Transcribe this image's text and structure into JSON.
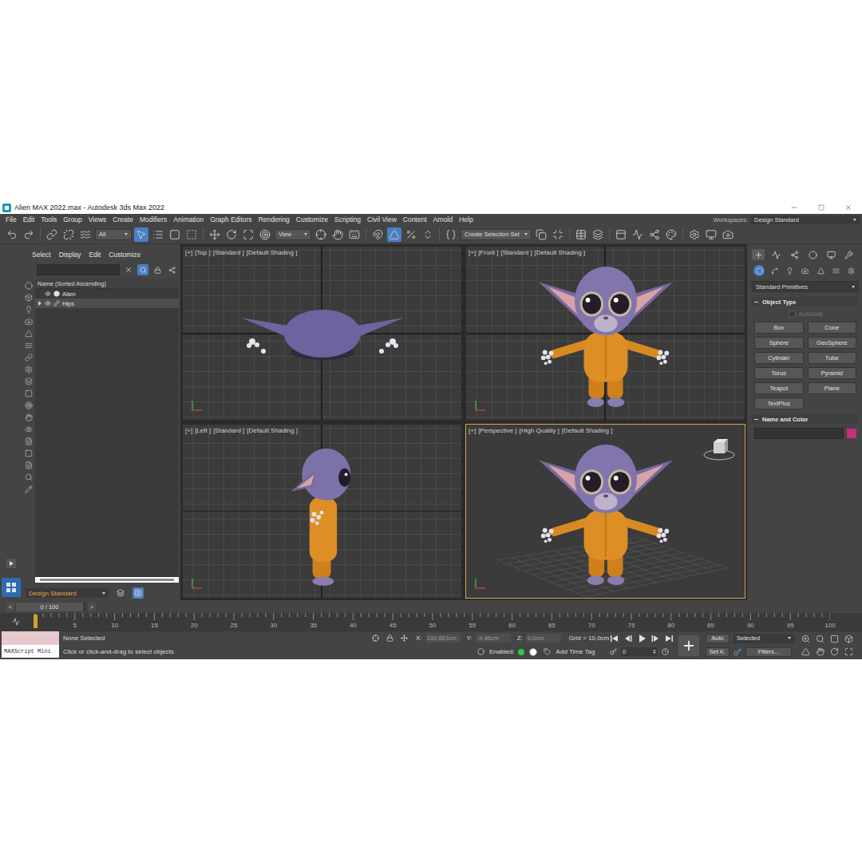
{
  "window": {
    "title": "Alien MAX 2022.max - Autodesk 3ds Max 2022"
  },
  "menu": [
    "File",
    "Edit",
    "Tools",
    "Group",
    "Views",
    "Create",
    "Modifiers",
    "Animation",
    "Graph Editors",
    "Rendering",
    "Customize",
    "Scripting",
    "Civil View",
    "Content",
    "Arnold",
    "Help"
  ],
  "workspace": {
    "label": "Workspaces:",
    "value": "Design Standard"
  },
  "toolbar": [
    {
      "kind": "button",
      "selected": false
    },
    {
      "kind": "button",
      "selected": false
    },
    {
      "kind": "separator"
    },
    {
      "kind": "button",
      "selected": false
    },
    {
      "kind": "button",
      "selected": false
    },
    {
      "kind": "button",
      "selected": false
    },
    {
      "kind": "dropdown",
      "value": "All"
    },
    {
      "kind": "button",
      "selected": true
    },
    {
      "kind": "button",
      "selected": false
    },
    {
      "kind": "button",
      "selected": false
    },
    {
      "kind": "button",
      "selected": false
    },
    {
      "kind": "separator"
    },
    {
      "kind": "button",
      "selected": false
    },
    {
      "kind": "button",
      "selected": false
    },
    {
      "kind": "button",
      "selected": false
    },
    {
      "kind": "button",
      "selected": false
    },
    {
      "kind": "dropdown",
      "value": "View"
    },
    {
      "kind": "button",
      "selected": false
    },
    {
      "kind": "button",
      "selected": false
    },
    {
      "kind": "button",
      "selected": false
    },
    {
      "kind": "separator"
    },
    {
      "kind": "button",
      "selected": false
    },
    {
      "kind": "button",
      "selected": true
    },
    {
      "kind": "button",
      "selected": false
    },
    {
      "kind": "button",
      "selected": false
    },
    {
      "kind": "separator"
    },
    {
      "kind": "button",
      "selected": false
    },
    {
      "kind": "dropdown",
      "value": "Create Selection Set"
    },
    {
      "kind": "button",
      "selected": false
    },
    {
      "kind": "button",
      "selected": false
    },
    {
      "kind": "separator"
    },
    {
      "kind": "button",
      "selected": false
    },
    {
      "kind": "button",
      "selected": false
    },
    {
      "kind": "separator"
    },
    {
      "kind": "button",
      "selected": false
    },
    {
      "kind": "button",
      "selected": false
    },
    {
      "kind": "button",
      "selected": false
    },
    {
      "kind": "button",
      "selected": false
    },
    {
      "kind": "separator"
    },
    {
      "kind": "button",
      "selected": false
    },
    {
      "kind": "button",
      "selected": false
    },
    {
      "kind": "button",
      "selected": false
    }
  ],
  "scene_explorer": {
    "menu": [
      "Select",
      "Display",
      "Edit",
      "Customize"
    ],
    "filter_on": true,
    "column": "Name (Sorted Ascending)",
    "items": [
      {
        "name": "Alien",
        "expandable": false,
        "expanded": false,
        "selected": false
      },
      {
        "name": "Hips",
        "expandable": true,
        "expanded": false,
        "selected": true
      }
    ],
    "layer": "Design Standard"
  },
  "viewports": [
    {
      "kind": "top",
      "labels": [
        "[+]",
        "[Top ]",
        "[Standard ]",
        "[Default Shading ]"
      ],
      "active": false
    },
    {
      "kind": "front",
      "labels": [
        "[+]",
        "[Front ]",
        "[Standard ]",
        "[Default Shading ]"
      ],
      "active": false
    },
    {
      "kind": "left",
      "labels": [
        "[+]",
        "[Left ]",
        "[Standard ]",
        "[Default Shading ]"
      ],
      "active": false
    },
    {
      "kind": "perspective",
      "labels": [
        "[+]",
        "[Perspective ]",
        "[High Quality ]",
        "[Default Shading ]"
      ],
      "active": true
    }
  ],
  "command_panel": {
    "tabs": [
      {
        "selected": true
      },
      {
        "selected": false
      },
      {
        "selected": false
      },
      {
        "selected": false
      },
      {
        "selected": false
      },
      {
        "selected": false
      }
    ],
    "categories": [
      {
        "selected": true
      },
      {
        "selected": false
      },
      {
        "selected": false
      },
      {
        "selected": false
      },
      {
        "selected": false
      },
      {
        "selected": false
      },
      {
        "selected": false
      }
    ],
    "category": "Standard Primitives",
    "object_type": {
      "title": "Object Type",
      "autogrid": {
        "label": "AutoGrid",
        "checked": false,
        "disabled": true
      },
      "buttons": [
        "Box",
        "Cone",
        "Sphere",
        "GeoSphere",
        "Cylinder",
        "Tube",
        "Torus",
        "Pyramid",
        "Teapot",
        "Plane",
        "TextPlus"
      ]
    },
    "name_and_color": {
      "title": "Name and Color",
      "name": "",
      "color": "#c2307e"
    }
  },
  "time_slider": {
    "prev": "<",
    "label": "0 / 100",
    "next": ">",
    "level": 0
  },
  "ruler": [
    "5",
    "10",
    "15",
    "20",
    "25",
    "30",
    "35",
    "40",
    "45",
    "50",
    "55",
    "60",
    "65",
    "70",
    "75",
    "80",
    "85",
    "90",
    "95",
    "100"
  ],
  "status": {
    "listener": "MAXScript Mini",
    "selection": "None Selected",
    "prompt": "Click or click-and-drag to select objects",
    "coords": [
      {
        "axis": "X:",
        "value": "100,883cm"
      },
      {
        "axis": "Y:",
        "value": "-9,46cm"
      },
      {
        "axis": "Z:",
        "value": "0,0cm"
      }
    ],
    "grid": "Grid = 10,0cm",
    "enabled": {
      "label": "Enabled:",
      "on": true
    },
    "time_tag": "Add Time Tag",
    "frame": "0",
    "auto_key": {
      "label": "Auto",
      "on": false
    },
    "key_set": "Selected",
    "set_key": "Set K.",
    "filters": "Filters..."
  }
}
